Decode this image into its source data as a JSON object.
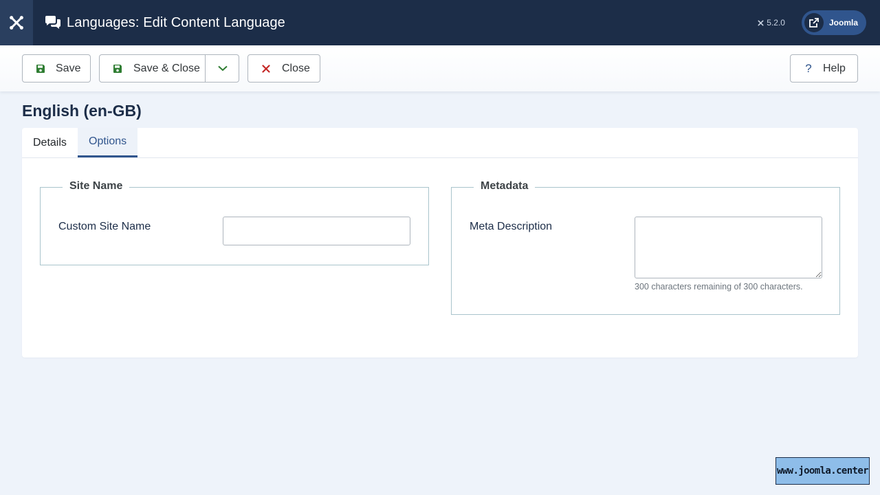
{
  "header": {
    "title": "Languages: Edit Content Language",
    "version": "5.2.0",
    "site_label": "Joomla",
    "logo_icon": "joomla-logo-icon",
    "page_icon": "comments-icon"
  },
  "toolbar": {
    "save_label": "Save",
    "save_close_label": "Save & Close",
    "close_label": "Close",
    "help_label": "Help",
    "help_glyph": "?"
  },
  "content": {
    "heading": "English (en-GB)",
    "tabs": [
      {
        "label": "Details",
        "active": false
      },
      {
        "label": "Options",
        "active": true
      }
    ]
  },
  "site_name": {
    "legend": "Site Name",
    "custom_label": "Custom Site Name",
    "custom_value": ""
  },
  "metadata": {
    "legend": "Metadata",
    "description_label": "Meta Description",
    "description_value": "",
    "chars_hint": "300 characters remaining of 300 characters."
  },
  "watermark": "www.joomla.center",
  "colors": {
    "header_bg": "#1c2d48",
    "accent": "#30558d",
    "save_green": "#2f7d32",
    "close_red": "#c52827",
    "page_bg": "#eef3fa"
  }
}
